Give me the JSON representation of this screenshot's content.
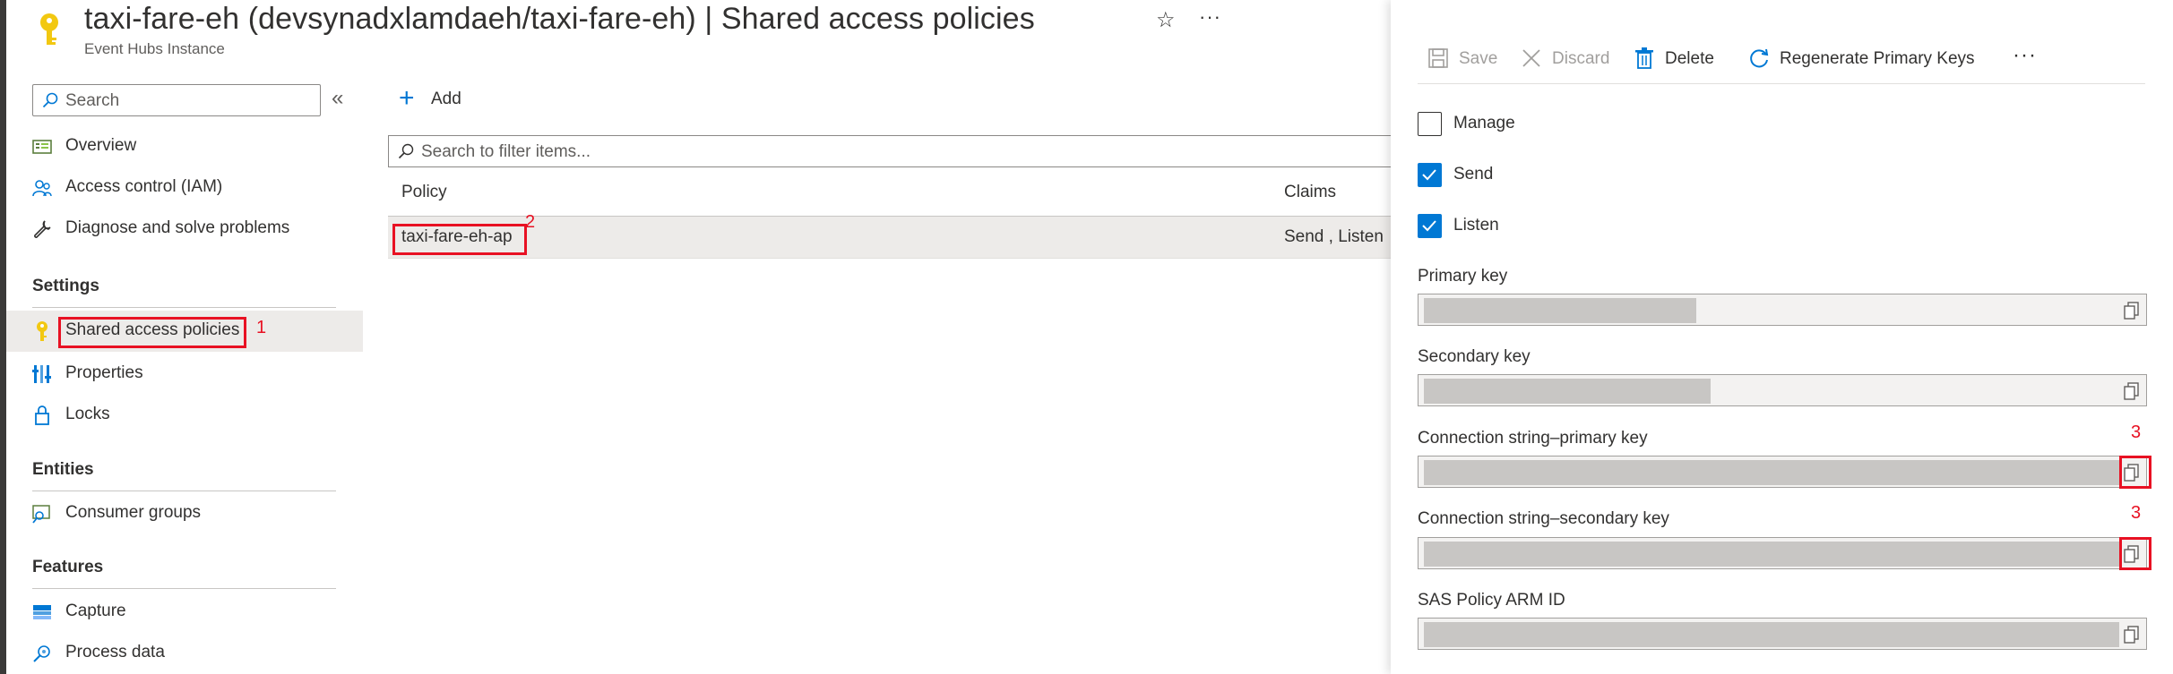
{
  "header": {
    "title": "taxi-fare-eh (devsynadxlamdaeh/taxi-fare-eh)",
    "title_sep": " | ",
    "page_name": "Shared access policies",
    "subtitle": "Event Hubs Instance",
    "icons": {
      "resource": "key-icon",
      "favorite": "star-icon",
      "more": "more-icon"
    }
  },
  "sidebar": {
    "search_placeholder": "Search",
    "collapse_glyph": "«",
    "items_top": [
      {
        "label": "Overview",
        "icon": "overview-icon"
      },
      {
        "label": "Access control (IAM)",
        "icon": "iam-icon"
      },
      {
        "label": "Diagnose and solve problems",
        "icon": "wrench-icon"
      }
    ],
    "settings": {
      "heading": "Settings",
      "items": [
        {
          "label": "Shared access policies",
          "icon": "key-icon",
          "selected": true
        },
        {
          "label": "Properties",
          "icon": "properties-icon"
        },
        {
          "label": "Locks",
          "icon": "lock-icon"
        }
      ]
    },
    "entities": {
      "heading": "Entities",
      "items": [
        {
          "label": "Consumer groups",
          "icon": "consumer-groups-icon"
        }
      ]
    },
    "features": {
      "heading": "Features",
      "items": [
        {
          "label": "Capture",
          "icon": "capture-icon"
        },
        {
          "label": "Process data",
          "icon": "process-data-icon"
        }
      ]
    }
  },
  "main": {
    "add_label": "Add",
    "filter_placeholder": "Search to filter items...",
    "columns": {
      "policy": "Policy",
      "claims": "Claims"
    },
    "rows": [
      {
        "policy": "taxi-fare-eh-ap",
        "claims": "Send , Listen"
      }
    ]
  },
  "panel": {
    "toolbar": {
      "save": "Save",
      "discard": "Discard",
      "delete": "Delete",
      "regenerate": "Regenerate Primary Keys",
      "more": "···"
    },
    "checkboxes": [
      {
        "label": "Manage",
        "checked": false
      },
      {
        "label": "Send",
        "checked": true
      },
      {
        "label": "Listen",
        "checked": true
      }
    ],
    "fields": [
      {
        "label": "Primary key",
        "mask_fraction": 0.38
      },
      {
        "label": "Secondary key",
        "mask_fraction": 0.4
      },
      {
        "label": "Connection string–primary key",
        "mask_fraction": 0.97
      },
      {
        "label": "Connection string–secondary key",
        "mask_fraction": 0.97
      },
      {
        "label": "SAS Policy ARM ID",
        "mask_fraction": 0.97
      }
    ]
  },
  "annotations": {
    "markers": [
      "1",
      "2",
      "3",
      "3"
    ],
    "color": "#e81123"
  },
  "colors": {
    "accent": "#0078d4",
    "key_yellow": "#f2c811",
    "selected_bg": "#edebe9"
  }
}
